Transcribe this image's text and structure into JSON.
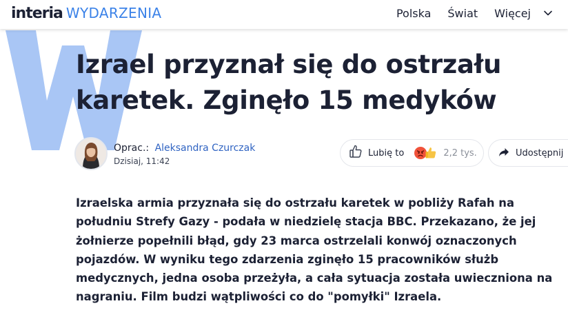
{
  "header": {
    "brand": "interia",
    "section": "WYDARZENIA",
    "nav": [
      "Polska",
      "Świat",
      "Więcej"
    ],
    "more_icon": "chevron-down-icon"
  },
  "article": {
    "title": "Izrael przyznał się do ostrzału karetek. Zginęło 15 medyków",
    "author_prefix": "Oprac.:",
    "author_name": "Aleksandra Czurczak",
    "date": "Dzisiaj, 11:42",
    "lead": "Izraelska armia przyznała się do ostrzału karetek w pobliży Rafah na południu Strefy Gazy - podała w niedzielę stacja BBC. Przekazano, że jej żołnierze popełnili błąd, gdy 23 marca ostrzelali konwój oznaczonych pojazdów. W wyniku tego zdarzenia zginęło 15 pracowników służb medycznych, jedna osoba przeżyła, a cała sytuacja została uwieczniona na nagraniu. Film budzi wątpliwości co do \"pomyłki\" Izraela."
  },
  "actions": {
    "like_label": "Lubię to",
    "reaction_icons": [
      "angry-emoji-icon",
      "thumbs-up-emoji-icon"
    ],
    "reaction_count": "2,2 tys.",
    "share_label": "Udostępnij"
  },
  "colors": {
    "accent": "#3b82e8",
    "watermark": "#a9c6f5",
    "text": "#1c2134",
    "link": "#2f63c2"
  }
}
